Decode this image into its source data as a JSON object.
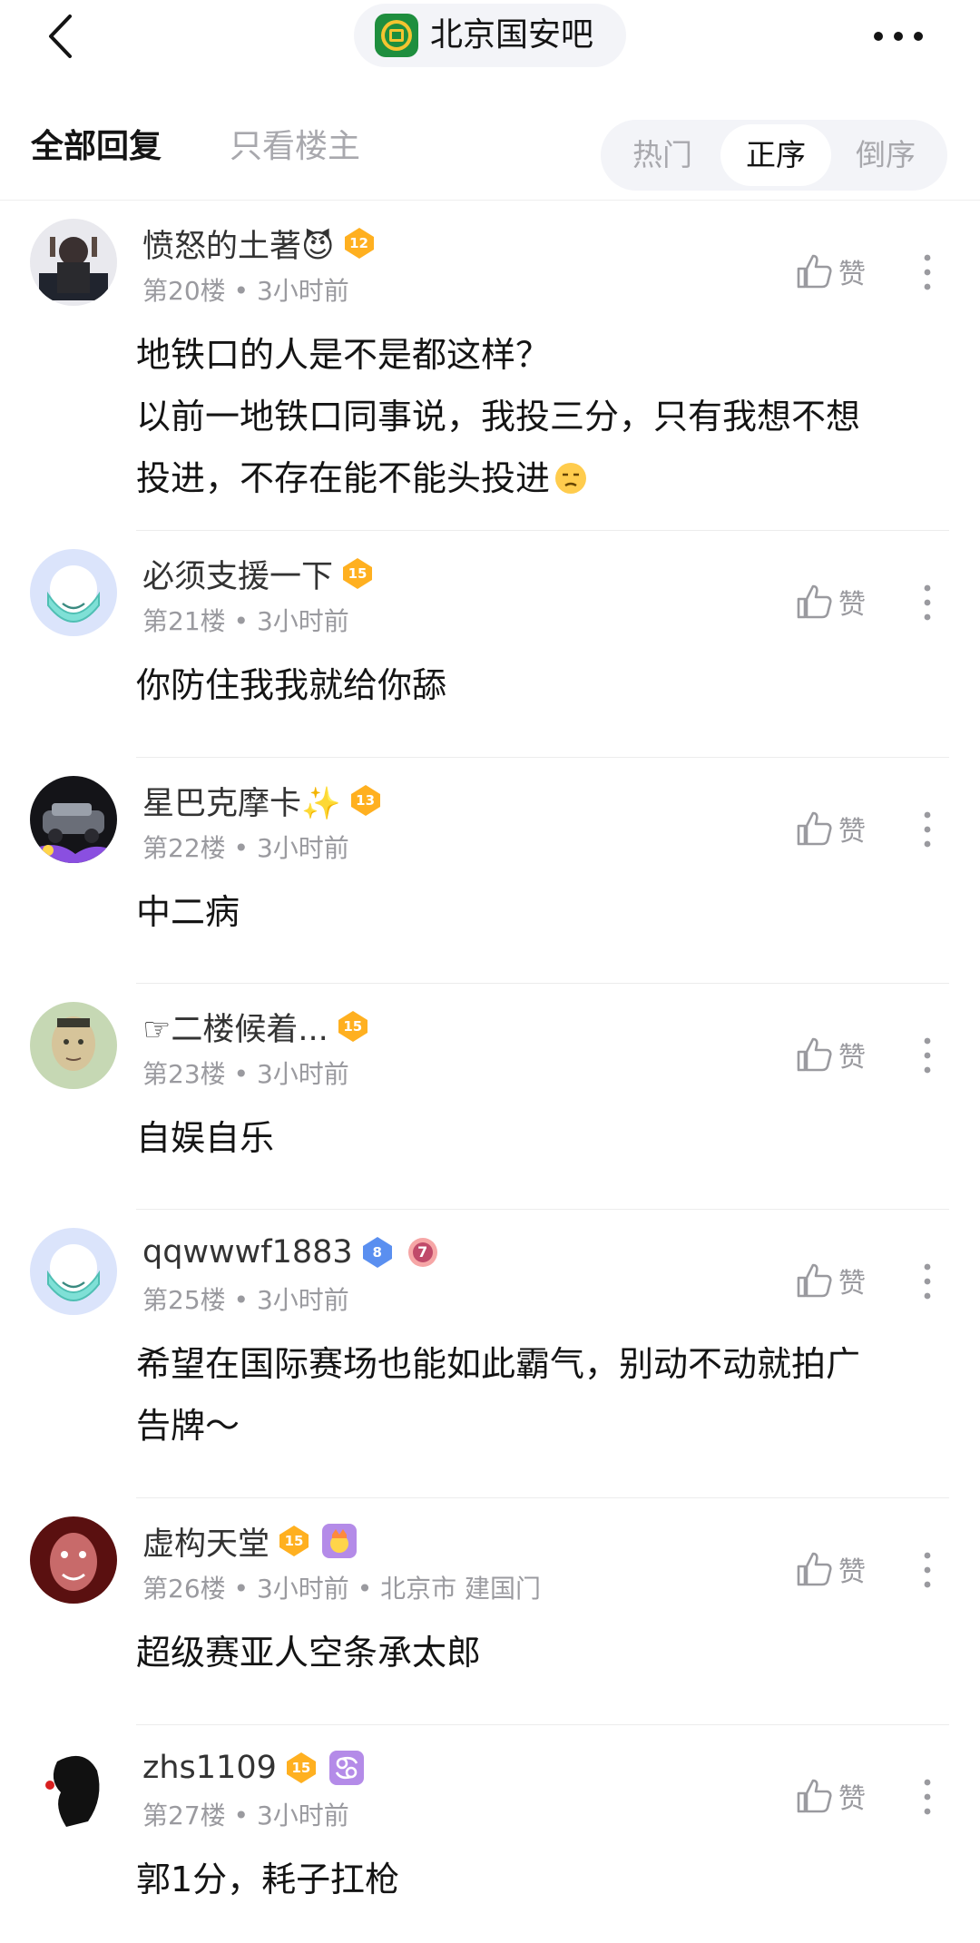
{
  "header": {
    "forum_title": "北京国安吧",
    "back_icon": "chevron-left-icon",
    "more_icon": "more-horizontal-icon"
  },
  "tabs": {
    "all_replies": "全部回复",
    "op_only": "只看楼主"
  },
  "sort": {
    "options": [
      "热门",
      "正序",
      "倒序"
    ],
    "selected": "正序"
  },
  "colors": {
    "level_orange": "#ffb020",
    "level_blue": "#5a8ff0",
    "badge_purple": "#b48be8"
  },
  "comments": [
    {
      "username": "愤怒的土著😈",
      "level": "12",
      "floor": "第20楼",
      "time": "3小时前",
      "location": "",
      "body_lines": [
        "地铁口的人是不是都这样？",
        "以前一地铁口同事说，我投三分，只有我想不想",
        "投进，不存在能不能头投进"
      ],
      "trailing_emoji": "unamused-face-emoji",
      "like_label": "赞"
    },
    {
      "username": "必须支援一下",
      "level": "15",
      "floor": "第21楼",
      "time": "3小时前",
      "location": "",
      "body_lines": [
        "你防住我我就给你舔"
      ],
      "like_label": "赞"
    },
    {
      "username": "星巴克摩卡✨",
      "level": "13",
      "floor": "第22楼",
      "time": "3小时前",
      "location": "",
      "body_lines": [
        "中二病"
      ],
      "like_label": "赞"
    },
    {
      "username": "☞二楼候着...",
      "level": "15",
      "floor": "第23楼",
      "time": "3小时前",
      "location": "",
      "body_lines": [
        "自娱自乐"
      ],
      "like_label": "赞"
    },
    {
      "username": "qqwwwf1883",
      "level": "8",
      "extra_badge": "7",
      "floor": "第25楼",
      "time": "3小时前",
      "location": "",
      "body_lines": [
        "希望在国际赛场也能如此霸气，别动不动就拍广",
        "告牌～"
      ],
      "like_label": "赞"
    },
    {
      "username": "虚构天堂",
      "level": "15",
      "floor": "第26楼",
      "time": "3小时前",
      "location": "北京市 建国门",
      "body_lines": [
        "超级赛亚人空条承太郎"
      ],
      "like_label": "赞"
    },
    {
      "username": "zhs1109",
      "level": "15",
      "floor": "第27楼",
      "time": "3小时前",
      "location": "",
      "body_lines": [
        "郭1分，耗子扛枪"
      ],
      "like_label": "赞"
    }
  ]
}
